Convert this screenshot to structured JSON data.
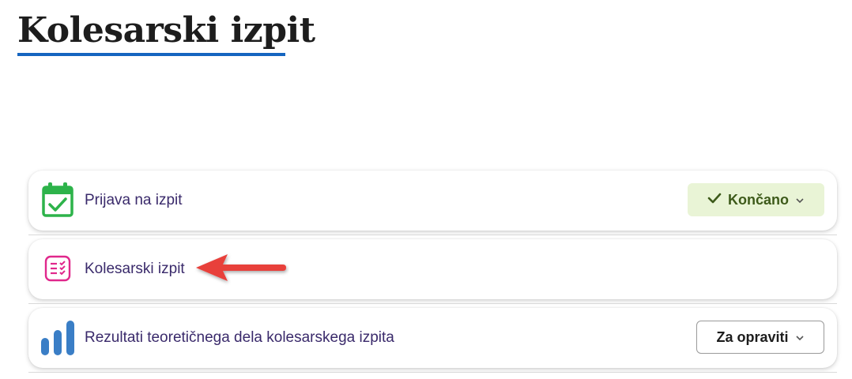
{
  "page": {
    "title": "Kolesarski izpit"
  },
  "items": [
    {
      "label": "Prijava na izpit",
      "icon": "calendar-check-icon",
      "status": "Končano",
      "status_icon": "checkmark-icon"
    },
    {
      "label": "Kolesarski izpit",
      "icon": "checklist-icon"
    },
    {
      "label": "Rezultati teoretičnega dela kolesarskega izpita",
      "icon": "bar-chart-icon",
      "status": "Za opraviti"
    }
  ],
  "colors": {
    "title_underline": "#1565c0",
    "label_text": "#3a2a6b",
    "done_bg": "#e9f4d6",
    "done_text": "#3d5a1a",
    "calendar_icon": "#2db34a",
    "checklist_icon": "#e0288c",
    "chart_icon": "#3a7ec6",
    "annotation_arrow": "#e8403a"
  }
}
